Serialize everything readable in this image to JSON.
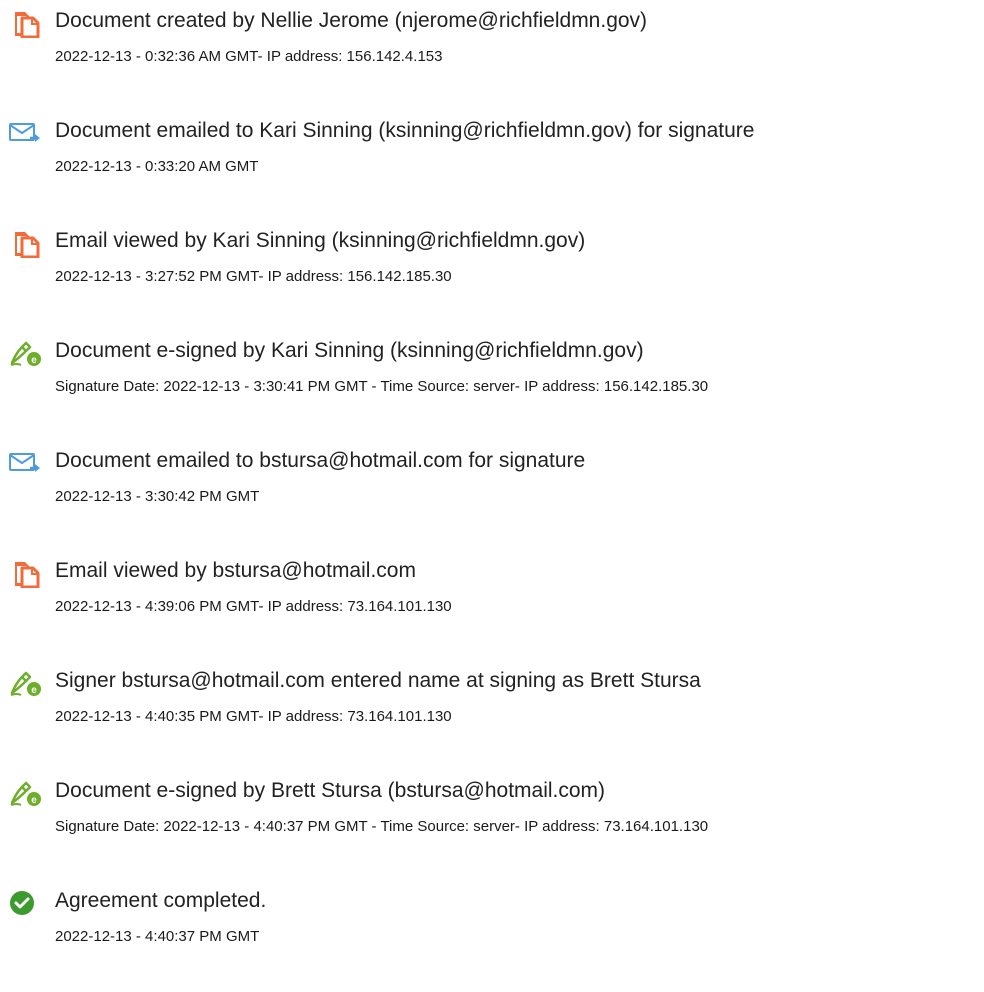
{
  "colors": {
    "document_icon": "#F26B3A",
    "email_icon": "#4D9BE0",
    "esign_icon": "#6FAE2B",
    "complete_icon": "#3C9B2F"
  },
  "events": [
    {
      "icon": "document-icon",
      "title": "Document created by Nellie Jerome (njerome@richfieldmn.gov)",
      "detail": "2022-12-13 - 0:32:36 AM GMT- IP address: 156.142.4.153"
    },
    {
      "icon": "email-sent-icon",
      "title": "Document emailed to Kari Sinning (ksinning@richfieldmn.gov) for signature",
      "detail": "2022-12-13 - 0:33:20 AM GMT"
    },
    {
      "icon": "document-icon",
      "title": "Email viewed by Kari Sinning (ksinning@richfieldmn.gov)",
      "detail": "2022-12-13 - 3:27:52 PM GMT- IP address: 156.142.185.30"
    },
    {
      "icon": "esign-pen-icon",
      "title": "Document e-signed by Kari Sinning (ksinning@richfieldmn.gov)",
      "detail": "Signature Date: 2022-12-13 - 3:30:41 PM GMT - Time Source: server- IP address: 156.142.185.30"
    },
    {
      "icon": "email-sent-icon",
      "title": "Document emailed to bstursa@hotmail.com for signature",
      "detail": "2022-12-13 - 3:30:42 PM GMT"
    },
    {
      "icon": "document-icon",
      "title": "Email viewed by bstursa@hotmail.com",
      "detail": "2022-12-13 - 4:39:06 PM GMT- IP address: 73.164.101.130"
    },
    {
      "icon": "esign-pen-icon",
      "title": "Signer bstursa@hotmail.com entered name at signing as Brett Stursa",
      "detail": "2022-12-13 - 4:40:35 PM GMT- IP address: 73.164.101.130"
    },
    {
      "icon": "esign-pen-icon",
      "title": "Document e-signed by Brett Stursa (bstursa@hotmail.com)",
      "detail": "Signature Date: 2022-12-13 - 4:40:37 PM GMT - Time Source: server- IP address: 73.164.101.130"
    },
    {
      "icon": "checkmark-circle-icon",
      "title": "Agreement completed.",
      "detail": "2022-12-13 - 4:40:37 PM GMT"
    }
  ]
}
